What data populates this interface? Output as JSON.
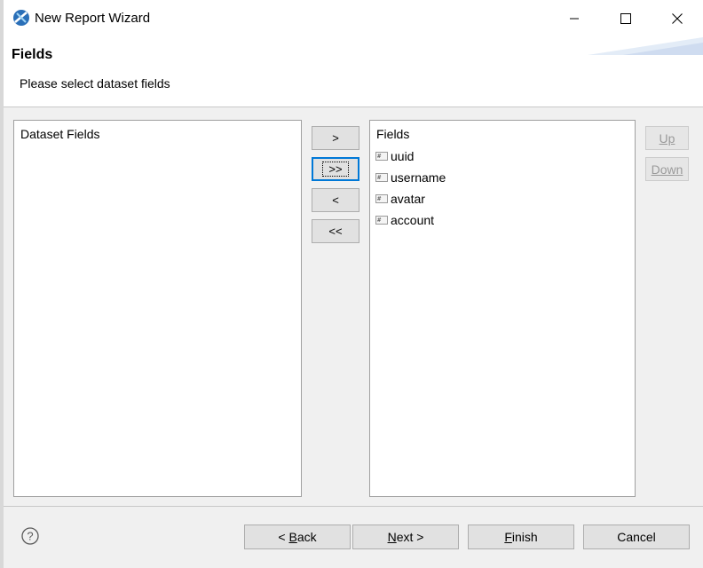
{
  "window": {
    "title": "New Report Wizard",
    "controls": {
      "minimize": "minimize-icon",
      "maximize": "maximize-icon",
      "close": "close-icon"
    }
  },
  "header": {
    "title": "Fields",
    "description": "Please select dataset fields"
  },
  "dataset_list": {
    "header": "Dataset Fields",
    "items": []
  },
  "transfer_buttons": {
    "add": ">",
    "add_all": ">>",
    "remove": "<",
    "remove_all": "<<"
  },
  "fields_list": {
    "header": "Fields",
    "items": [
      {
        "label": "uuid",
        "icon": "field-icon"
      },
      {
        "label": "username",
        "icon": "field-icon"
      },
      {
        "label": "avatar",
        "icon": "field-icon"
      },
      {
        "label": "account",
        "icon": "field-icon"
      }
    ]
  },
  "order_buttons": {
    "up": "Up",
    "down": "Down"
  },
  "footer": {
    "help_icon": "help-icon",
    "back": {
      "prefix": "< ",
      "mnemonic": "B",
      "rest": "ack"
    },
    "next": {
      "mnemonic": "N",
      "rest": "ext >"
    },
    "finish": {
      "mnemonic": "F",
      "rest": "inish"
    },
    "cancel": "Cancel"
  },
  "colors": {
    "accent": "#0078d7",
    "window_bg": "#f0f0f0",
    "button_bg": "#e1e1e1"
  }
}
